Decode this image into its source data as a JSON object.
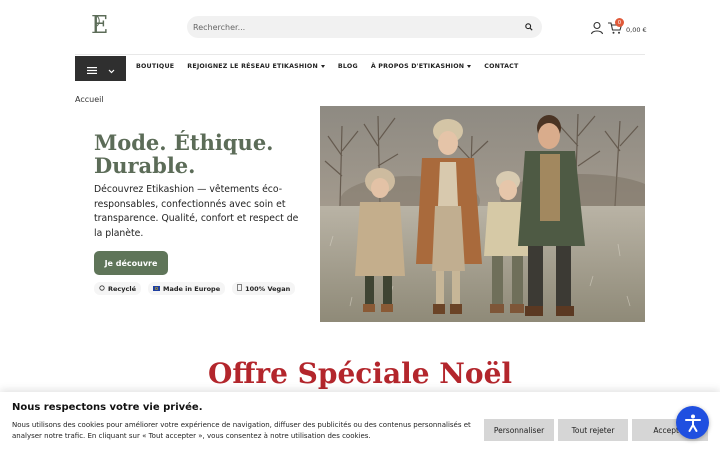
{
  "brand": {
    "logo_letter": "E",
    "logo_color": "#5c6c58"
  },
  "header": {
    "search_placeholder": "Rechercher...",
    "cart_count": "0",
    "cart_total": "0,00 €"
  },
  "nav": {
    "items": [
      {
        "label": "BOUTIQUE",
        "has_dropdown": false
      },
      {
        "label": "REJOIGNEZ LE RÉSEAU ETIKASHION",
        "has_dropdown": true
      },
      {
        "label": "BLOG",
        "has_dropdown": false
      },
      {
        "label": "À PROPOS D'ETIKASHION",
        "has_dropdown": true
      },
      {
        "label": "CONTACT",
        "has_dropdown": false
      }
    ]
  },
  "breadcrumb": "Accueil",
  "hero": {
    "title_line1": "Mode. Éthique.",
    "title_line2": "Durable.",
    "description": "Découvrez Etikashion — vêtements éco-responsables, confectionnés avec soin et transparence. Qualité, confort et respect de la planète.",
    "cta_label": "Je découvre",
    "badges": [
      {
        "icon": "recycle-icon",
        "label": "Recyclé"
      },
      {
        "icon": "eu-flag-icon",
        "label": "Made in Europe"
      },
      {
        "icon": "leaf-icon",
        "label": "100% Vegan"
      }
    ]
  },
  "offer": {
    "title_regular": "Offre Spéciale",
    "title_bold": "Noël"
  },
  "cookie": {
    "title": "Nous respectons votre vie privée.",
    "text": "Nous utilisons des cookies pour améliorer votre expérience de navigation, diffuser des publicités ou des contenus personnalisés et analyser notre trafic. En cliquant sur « Tout accepter », vous consentez à notre utilisation des cookies.",
    "customize_label": "Personnaliser",
    "reject_label": "Tout rejeter",
    "accept_label": "Accepter"
  },
  "colors": {
    "accent_green": "#5f7559",
    "offer_red": "#b3262c",
    "a11y_blue": "#1f4fe0"
  }
}
